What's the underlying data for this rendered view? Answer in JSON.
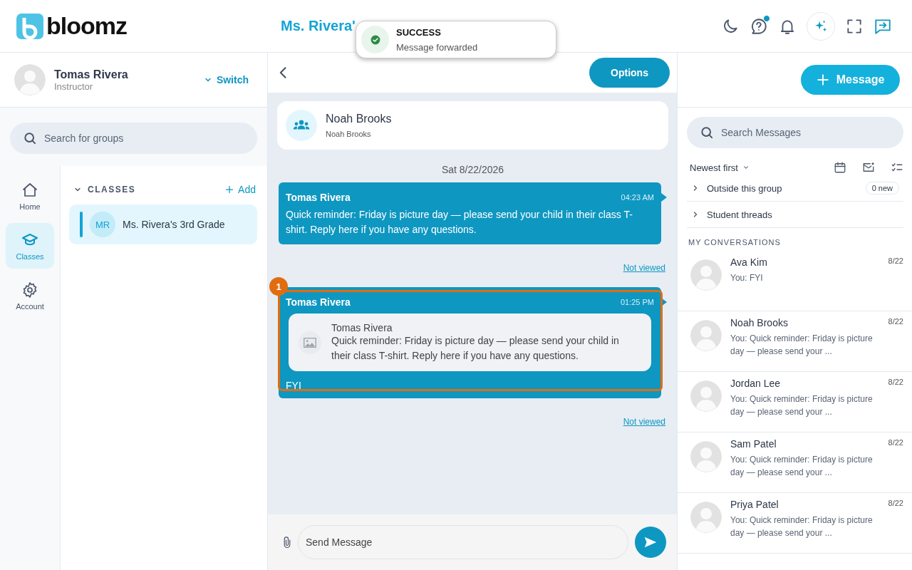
{
  "header": {
    "logo": "bloomz",
    "title": "Ms. Rivera'",
    "help_badge": true
  },
  "toast": {
    "title": "SUCCESS",
    "message": "Message forwarded"
  },
  "profile": {
    "name": "Tomas Rivera",
    "role": "Instructor",
    "switch": "Switch"
  },
  "group_search": {
    "placeholder": "Search for groups"
  },
  "nav": [
    {
      "label": "Home",
      "selected": false
    },
    {
      "label": "Classes",
      "selected": true
    },
    {
      "label": "Account",
      "selected": false
    }
  ],
  "classes": {
    "heading": "CLASSES",
    "expanded": true,
    "add": "Add",
    "items": [
      {
        "initials": "MR",
        "name": "Ms. Rivera's 3rd Grade",
        "selected": true
      }
    ]
  },
  "chat": {
    "options": "Options",
    "recipient": {
      "name": "Noah Brooks",
      "subtitle": "Noah Brooks"
    },
    "date": "Sat 8/22/2026",
    "messages": [
      {
        "kind": "text",
        "sender": "Tomas Rivera",
        "time": "04:23 AM",
        "text": "Quick reminder: Friday is picture day — please send your child in their class T-shirt. Reply here if you have any questions.",
        "status": "Not viewed",
        "highlighted": false
      },
      {
        "kind": "forward",
        "sender": "Tomas Rivera",
        "time": "01:25 PM",
        "quoted_sender": "Tomas Rivera",
        "quoted_text": "Quick reminder: Friday is picture day — please send your child in their class T-shirt. Reply here if you have any questions.",
        "text": "FYI",
        "status": "Not viewed",
        "highlighted": true,
        "marker": "1"
      }
    ],
    "composer": {
      "placeholder": "Send Message"
    }
  },
  "inbox": {
    "new_message": "Message",
    "search": {
      "placeholder": "Search Messages"
    },
    "sort": "Newest first",
    "folders": [
      {
        "label": "Outside this group",
        "expanded": false,
        "badge": "0 new"
      },
      {
        "label": "Student threads",
        "expanded": false
      }
    ],
    "section": "MY CONVERSATIONS",
    "conversations": [
      {
        "name": "Ava Kim",
        "preview": "You: FYI",
        "date": "8/22"
      },
      {
        "name": "Noah Brooks",
        "preview": "You: Quick reminder: Friday is picture day — please send your ...",
        "date": "8/22"
      },
      {
        "name": "Jordan Lee",
        "preview": "You: Quick reminder: Friday is picture day — please send your ...",
        "date": "8/22"
      },
      {
        "name": "Sam Patel",
        "preview": "You: Quick reminder: Friday is picture day — please send your ...",
        "date": "8/22"
      },
      {
        "name": "Priya Patel",
        "preview": "You: Quick reminder: Friday is picture day — please send your ...",
        "date": "8/22"
      }
    ]
  }
}
